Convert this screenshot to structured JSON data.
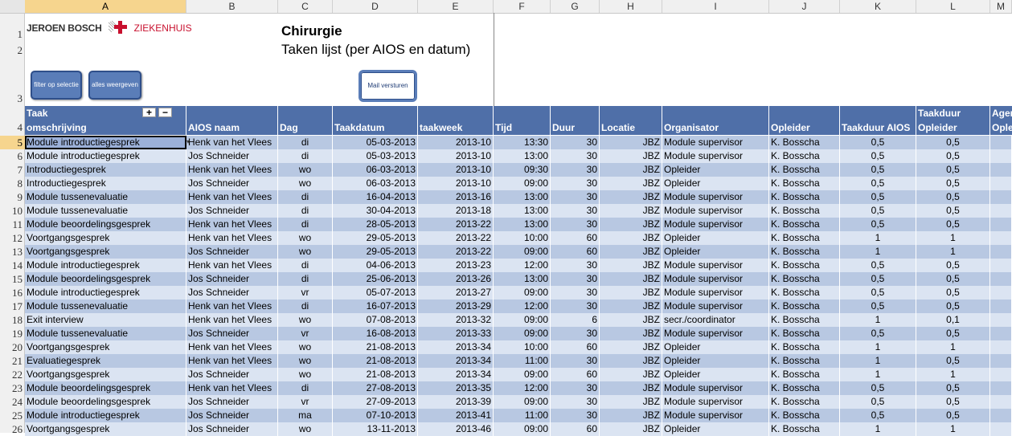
{
  "columns": [
    "A",
    "B",
    "C",
    "D",
    "E",
    "F",
    "G",
    "H",
    "I",
    "J",
    "K",
    "L",
    "M"
  ],
  "row_numbers": [
    "1",
    "2",
    "3",
    "4"
  ],
  "logo": {
    "name_bold": "JEROEN BOSCH",
    "name_light": "ZIEKENHUIS",
    "accent": "#c8102e"
  },
  "title": "Chirurgie",
  "subtitle": "Taken lijst (per AIOS en datum)",
  "buttons": {
    "filter": "filter op selectie",
    "all": "alles weergeven",
    "mail": "Mail versturen"
  },
  "group_plus": "+",
  "group_minus": "−",
  "headers": [
    "Taak omschrijving",
    "AIOS naam",
    "Dag",
    "Taakdatum",
    "taakweek",
    "Tijd",
    "Duur",
    "Locatie",
    "Organisator",
    "Opleider",
    "Taakduur AIOS",
    "Taakduur Opleider",
    "Agenda Opleider"
  ],
  "header_top": {
    "a": "Taak",
    "l": "Taakduur",
    "m": "Agen"
  },
  "header_bottom": {
    "a": "omschrijving",
    "l": "Opleider",
    "m": "Ople"
  },
  "rows": [
    {
      "n": "5",
      "a": "Module introductiegesprek",
      "b": "Henk van het Vlees",
      "c": "di",
      "d": "05-03-2013",
      "e": "2013-10",
      "f": "13:30",
      "g": "30",
      "h": "JBZ",
      "i": "Module supervisor",
      "j": "K. Bosscha",
      "k": "0,5",
      "l": "0,5"
    },
    {
      "n": "6",
      "a": "Module introductiegesprek",
      "b": "Jos Schneider",
      "c": "di",
      "d": "05-03-2013",
      "e": "2013-10",
      "f": "13:00",
      "g": "30",
      "h": "JBZ",
      "i": "Module supervisor",
      "j": "K. Bosscha",
      "k": "0,5",
      "l": "0,5"
    },
    {
      "n": "7",
      "a": "Introductiegesprek",
      "b": "Henk van het Vlees",
      "c": "wo",
      "d": "06-03-2013",
      "e": "2013-10",
      "f": "09:30",
      "g": "30",
      "h": "JBZ",
      "i": "Opleider",
      "j": "K. Bosscha",
      "k": "0,5",
      "l": "0,5"
    },
    {
      "n": "8",
      "a": "Introductiegesprek",
      "b": "Jos Schneider",
      "c": "wo",
      "d": "06-03-2013",
      "e": "2013-10",
      "f": "09:00",
      "g": "30",
      "h": "JBZ",
      "i": "Opleider",
      "j": "K. Bosscha",
      "k": "0,5",
      "l": "0,5"
    },
    {
      "n": "9",
      "a": "Module tussenevaluatie",
      "b": "Henk van het Vlees",
      "c": "di",
      "d": "16-04-2013",
      "e": "2013-16",
      "f": "13:00",
      "g": "30",
      "h": "JBZ",
      "i": "Module supervisor",
      "j": "K. Bosscha",
      "k": "0,5",
      "l": "0,5"
    },
    {
      "n": "10",
      "a": "Module tussenevaluatie",
      "b": "Jos Schneider",
      "c": "di",
      "d": "30-04-2013",
      "e": "2013-18",
      "f": "13:00",
      "g": "30",
      "h": "JBZ",
      "i": "Module supervisor",
      "j": "K. Bosscha",
      "k": "0,5",
      "l": "0,5"
    },
    {
      "n": "11",
      "a": "Module beoordelingsgesprek",
      "b": "Henk van het Vlees",
      "c": "di",
      "d": "28-05-2013",
      "e": "2013-22",
      "f": "13:00",
      "g": "30",
      "h": "JBZ",
      "i": "Module supervisor",
      "j": "K. Bosscha",
      "k": "0,5",
      "l": "0,5"
    },
    {
      "n": "12",
      "a": "Voortgangsgesprek",
      "b": "Henk van het Vlees",
      "c": "wo",
      "d": "29-05-2013",
      "e": "2013-22",
      "f": "10:00",
      "g": "60",
      "h": "JBZ",
      "i": "Opleider",
      "j": "K. Bosscha",
      "k": "1",
      "l": "1"
    },
    {
      "n": "13",
      "a": "Voortgangsgesprek",
      "b": "Jos Schneider",
      "c": "wo",
      "d": "29-05-2013",
      "e": "2013-22",
      "f": "09:00",
      "g": "60",
      "h": "JBZ",
      "i": "Opleider",
      "j": "K. Bosscha",
      "k": "1",
      "l": "1"
    },
    {
      "n": "14",
      "a": "Module introductiegesprek",
      "b": "Henk van het Vlees",
      "c": "di",
      "d": "04-06-2013",
      "e": "2013-23",
      "f": "12:00",
      "g": "30",
      "h": "JBZ",
      "i": "Module supervisor",
      "j": "K. Bosscha",
      "k": "0,5",
      "l": "0,5"
    },
    {
      "n": "15",
      "a": "Module beoordelingsgesprek",
      "b": "Jos Schneider",
      "c": "di",
      "d": "25-06-2013",
      "e": "2013-26",
      "f": "13:00",
      "g": "30",
      "h": "JBZ",
      "i": "Module supervisor",
      "j": "K. Bosscha",
      "k": "0,5",
      "l": "0,5"
    },
    {
      "n": "16",
      "a": "Module introductiegesprek",
      "b": "Jos Schneider",
      "c": "vr",
      "d": "05-07-2013",
      "e": "2013-27",
      "f": "09:00",
      "g": "30",
      "h": "JBZ",
      "i": "Module supervisor",
      "j": "K. Bosscha",
      "k": "0,5",
      "l": "0,5"
    },
    {
      "n": "17",
      "a": "Module tussenevaluatie",
      "b": "Henk van het Vlees",
      "c": "di",
      "d": "16-07-2013",
      "e": "2013-29",
      "f": "12:00",
      "g": "30",
      "h": "JBZ",
      "i": "Module supervisor",
      "j": "K. Bosscha",
      "k": "0,5",
      "l": "0,5"
    },
    {
      "n": "18",
      "a": "Exit interview",
      "b": "Henk van het Vlees",
      "c": "wo",
      "d": "07-08-2013",
      "e": "2013-32",
      "f": "09:00",
      "g": "6",
      "h": "JBZ",
      "i": "secr./coordinator",
      "j": "K. Bosscha",
      "k": "1",
      "l": "0,1"
    },
    {
      "n": "19",
      "a": "Module tussenevaluatie",
      "b": "Jos Schneider",
      "c": "vr",
      "d": "16-08-2013",
      "e": "2013-33",
      "f": "09:00",
      "g": "30",
      "h": "JBZ",
      "i": "Module supervisor",
      "j": "K. Bosscha",
      "k": "0,5",
      "l": "0,5"
    },
    {
      "n": "20",
      "a": "Voortgangsgesprek",
      "b": "Henk van het Vlees",
      "c": "wo",
      "d": "21-08-2013",
      "e": "2013-34",
      "f": "10:00",
      "g": "60",
      "h": "JBZ",
      "i": "Opleider",
      "j": "K. Bosscha",
      "k": "1",
      "l": "1"
    },
    {
      "n": "21",
      "a": "Evaluatiegesprek",
      "b": "Henk van het Vlees",
      "c": "wo",
      "d": "21-08-2013",
      "e": "2013-34",
      "f": "11:00",
      "g": "30",
      "h": "JBZ",
      "i": "Opleider",
      "j": "K. Bosscha",
      "k": "1",
      "l": "0,5"
    },
    {
      "n": "22",
      "a": "Voortgangsgesprek",
      "b": "Jos Schneider",
      "c": "wo",
      "d": "21-08-2013",
      "e": "2013-34",
      "f": "09:00",
      "g": "60",
      "h": "JBZ",
      "i": "Opleider",
      "j": "K. Bosscha",
      "k": "1",
      "l": "1"
    },
    {
      "n": "23",
      "a": "Module beoordelingsgesprek",
      "b": "Henk van het Vlees",
      "c": "di",
      "d": "27-08-2013",
      "e": "2013-35",
      "f": "12:00",
      "g": "30",
      "h": "JBZ",
      "i": "Module supervisor",
      "j": "K. Bosscha",
      "k": "0,5",
      "l": "0,5"
    },
    {
      "n": "24",
      "a": "Module beoordelingsgesprek",
      "b": "Jos Schneider",
      "c": "vr",
      "d": "27-09-2013",
      "e": "2013-39",
      "f": "09:00",
      "g": "30",
      "h": "JBZ",
      "i": "Module supervisor",
      "j": "K. Bosscha",
      "k": "0,5",
      "l": "0,5"
    },
    {
      "n": "25",
      "a": "Module introductiegesprek",
      "b": "Jos Schneider",
      "c": "ma",
      "d": "07-10-2013",
      "e": "2013-41",
      "f": "11:00",
      "g": "30",
      "h": "JBZ",
      "i": "Module supervisor",
      "j": "K. Bosscha",
      "k": "0,5",
      "l": "0,5"
    },
    {
      "n": "26",
      "a": "Voortgangsgesprek",
      "b": "Jos Schneider",
      "c": "wo",
      "d": "13-11-2013",
      "e": "2013-46",
      "f": "09:00",
      "g": "60",
      "h": "JBZ",
      "i": "Opleider",
      "j": "K. Bosscha",
      "k": "1",
      "l": "1"
    }
  ]
}
